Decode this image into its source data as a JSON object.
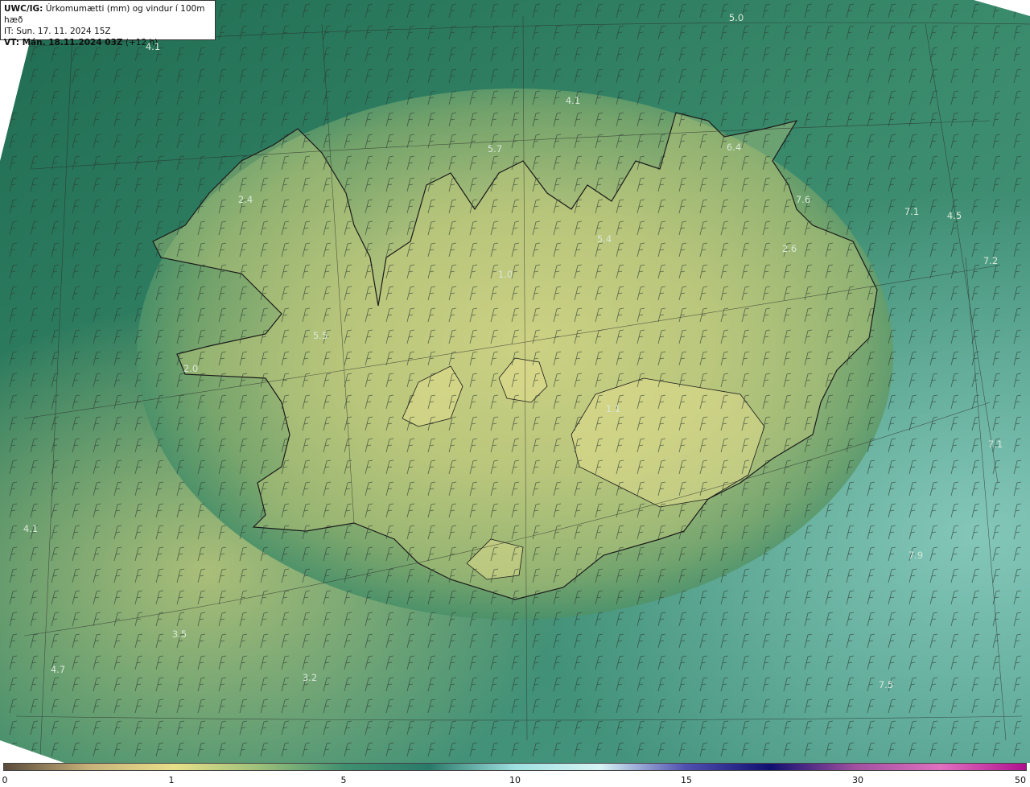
{
  "header": {
    "line1_bold": "UWC/IG:",
    "line1_rest": " Úrkomumætti (mm) og vindur í 100m hæð",
    "line2": "IT: Sun. 17. 11. 2024 15Z",
    "line3_bold": "VT: Mán. 18.11.2024 03Z",
    "line3_rest": " (+12 h)"
  },
  "colors": {
    "ocean_dark": "#1f6e55",
    "ocean_mid": "#3a8a6a",
    "land_yellow": "#cfd485",
    "land_green": "#8fb06e",
    "light_teal": "#6fb3a0",
    "coast": "#1a1a1a"
  },
  "value_labels": [
    {
      "text": "5.0"
    },
    {
      "text": "4.1"
    },
    {
      "text": "4.1"
    },
    {
      "text": "5.7"
    },
    {
      "text": "6.4"
    },
    {
      "text": "2.4"
    },
    {
      "text": "7.6"
    },
    {
      "text": "7.1"
    },
    {
      "text": "4.5"
    },
    {
      "text": "5.4"
    },
    {
      "text": "2.6"
    },
    {
      "text": "7.2"
    },
    {
      "text": "1.0"
    },
    {
      "text": "5.5"
    },
    {
      "text": "2.0"
    },
    {
      "text": "1.1"
    },
    {
      "text": "7.1"
    },
    {
      "text": "4.1"
    },
    {
      "text": "7.9"
    },
    {
      "text": "3.5"
    },
    {
      "text": "4.7"
    },
    {
      "text": "3.2"
    },
    {
      "text": "7.5"
    }
  ],
  "colorbar": {
    "ticks": [
      {
        "text": "0",
        "value": 0
      },
      {
        "text": "1",
        "value": 1
      },
      {
        "text": "5",
        "value": 5
      },
      {
        "text": "10",
        "value": 10
      },
      {
        "text": "15",
        "value": 15
      },
      {
        "text": "30",
        "value": 30
      },
      {
        "text": "50",
        "value": 50
      }
    ],
    "stops": [
      "#5a4a3a",
      "#c8b27a",
      "#e8e08a",
      "#9cc07a",
      "#3f8f70",
      "#2a7a6a",
      "#9ee0e0",
      "#d8f4f4",
      "#5050b0",
      "#101070",
      "#a050a0",
      "#e070c0",
      "#b01090"
    ]
  }
}
